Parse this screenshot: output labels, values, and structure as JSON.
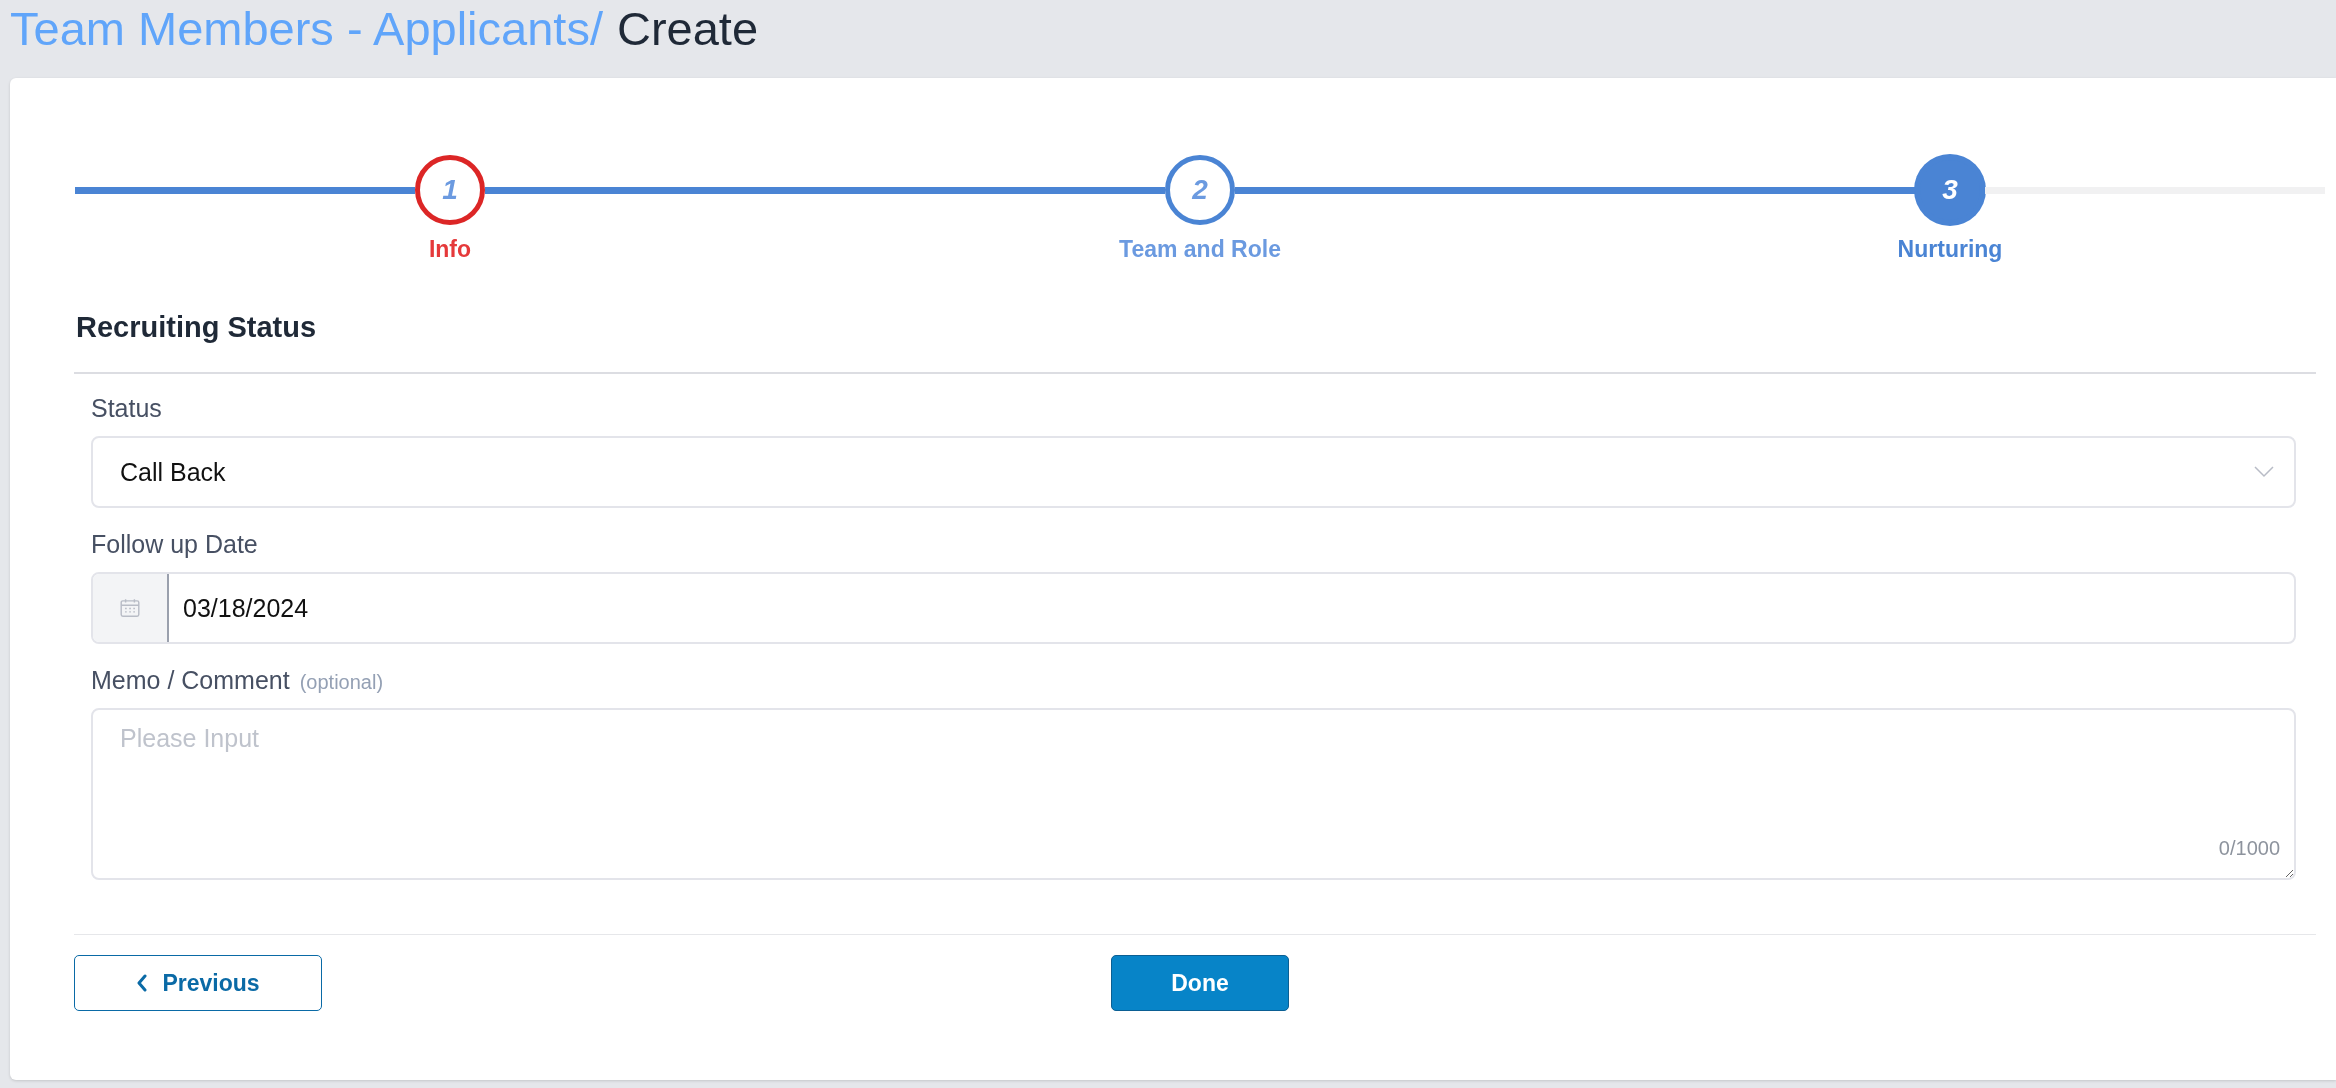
{
  "breadcrumb": {
    "parent": "Team Members - Applicants/",
    "current": "Create"
  },
  "steps": [
    {
      "number": "1",
      "label": "Info",
      "kind": "error",
      "selected": false
    },
    {
      "number": "2",
      "label": "Team and Role",
      "kind": "complete",
      "selected": false
    },
    {
      "number": "3",
      "label": "Nurturing",
      "kind": "current",
      "selected": true
    }
  ],
  "section": {
    "title": "Recruiting Status"
  },
  "fields": [
    {
      "kind": "select",
      "label": "Status",
      "value": "Call Back"
    },
    {
      "kind": "date",
      "label": "Follow up Date",
      "value": "03/18/2024"
    },
    {
      "kind": "textarea",
      "label": "Memo / Comment",
      "hint": "(optional)",
      "placeholder": "Please Input",
      "counter": "0/1000"
    }
  ],
  "buttons": {
    "previous": "Previous",
    "done": "Done"
  }
}
